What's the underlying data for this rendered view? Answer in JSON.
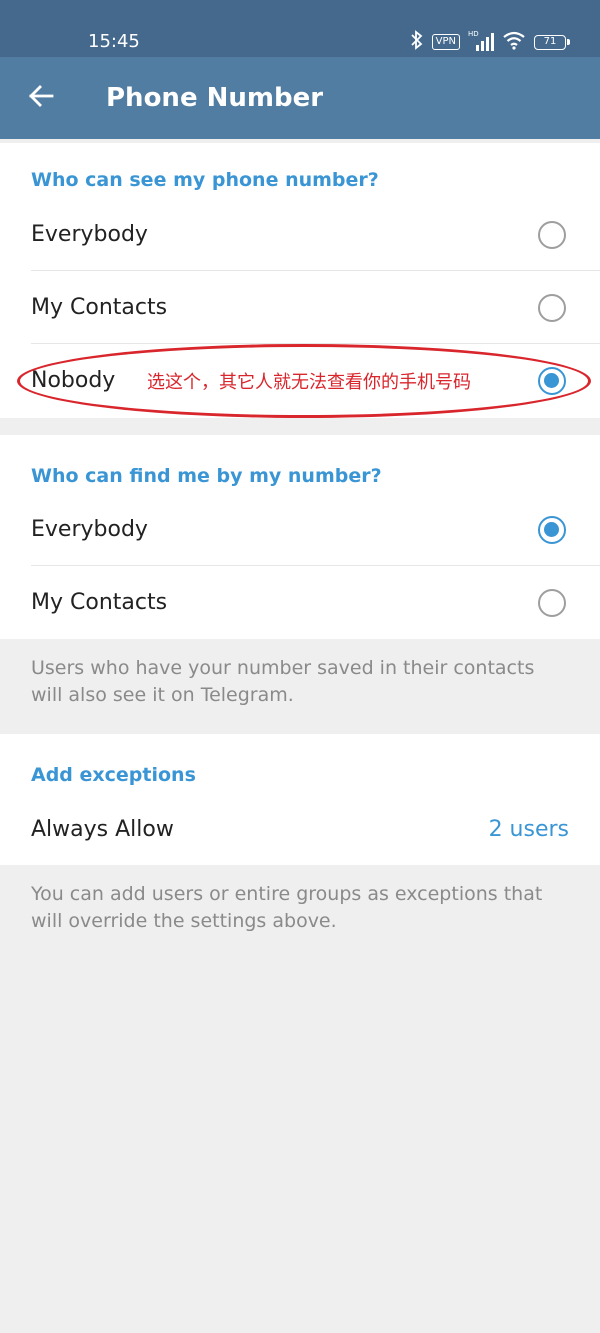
{
  "status_bar": {
    "time": "15:45",
    "vpn_label": "VPN",
    "hd_label": "HD",
    "battery_level": "71",
    "icons": [
      "bluetooth-icon",
      "vpn-icon",
      "signal-icon",
      "wifi-icon",
      "battery-icon"
    ]
  },
  "app_bar": {
    "title": "Phone Number",
    "back_icon": "arrow-left-icon"
  },
  "section_see": {
    "header": "Who can see my phone number?",
    "options": [
      {
        "label": "Everybody",
        "selected": false
      },
      {
        "label": "My Contacts",
        "selected": false
      },
      {
        "label": "Nobody",
        "selected": true
      }
    ]
  },
  "annotation": {
    "text": "选这个，其它人就无法查看你的手机号码",
    "color": "#d9262c"
  },
  "section_find": {
    "header": "Who can find me by my number?",
    "options": [
      {
        "label": "Everybody",
        "selected": true
      },
      {
        "label": "My Contacts",
        "selected": false
      }
    ],
    "info": "Users who have your number saved in their contacts will also see it on Telegram."
  },
  "section_exceptions": {
    "header": "Add exceptions",
    "always_allow_label": "Always Allow",
    "always_allow_value": "2 users",
    "info": "You can add users or entire groups as exceptions that will override the settings above."
  },
  "colors": {
    "status_bar": "#44698d",
    "app_bar": "#527da3",
    "accent": "#3a95d5",
    "background": "#efefef"
  }
}
